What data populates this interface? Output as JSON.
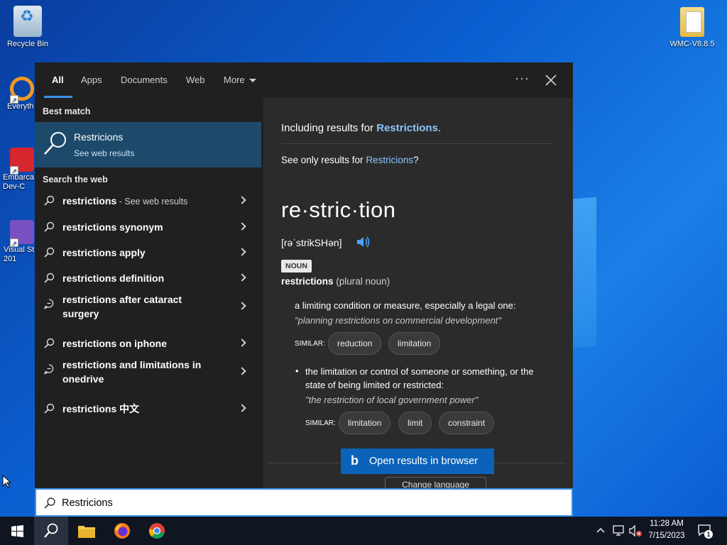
{
  "desktop": {
    "icons": [
      {
        "label": "Recycle Bin"
      },
      {
        "label": "WMC-V8.8.5"
      },
      {
        "label": "Everyth"
      },
      {
        "label": "Embarca Dev-C"
      },
      {
        "label": "Visual St 201"
      }
    ]
  },
  "tabs": [
    {
      "label": "All",
      "active": true
    },
    {
      "label": "Apps"
    },
    {
      "label": "Documents"
    },
    {
      "label": "Web"
    },
    {
      "label": "More"
    }
  ],
  "header_icons": {
    "more": "more-options-icon",
    "close": "close-icon"
  },
  "left": {
    "best_match_title": "Best match",
    "best_match": {
      "title": "Restricions",
      "subtitle": "See web results"
    },
    "web_title": "Search the web",
    "results": [
      {
        "text": "restrictions",
        "hint": " - See web results",
        "icon": "search-icon"
      },
      {
        "text": "restrictions synonym",
        "hint": "",
        "icon": "search-icon"
      },
      {
        "text": "restrictions apply",
        "hint": "",
        "icon": "search-icon"
      },
      {
        "text": "restrictions definition",
        "hint": "",
        "icon": "search-icon"
      },
      {
        "text": "restrictions after cataract surgery",
        "hint": "",
        "icon": "chat-bubble-icon"
      },
      {
        "text": "restrictions on iphone",
        "hint": "",
        "icon": "search-icon"
      },
      {
        "text": "restrictions and limitations in onedrive",
        "hint": "",
        "icon": "chat-bubble-icon"
      },
      {
        "text": "restrictions 中文",
        "hint": "",
        "icon": "search-icon"
      }
    ]
  },
  "right": {
    "including_prefix": "Including results for ",
    "including_term": "Restrictions",
    "including_suffix": ".",
    "only_prefix": "See only results for ",
    "only_term": "Restricions",
    "only_suffix": "?",
    "headword": "re·stric·tion",
    "pronunciation": "[rəˈstrikSHən]",
    "part_of_speech": "NOUN",
    "lemma": "restrictions",
    "lemma_note": " (plural noun)",
    "senses": [
      {
        "definition": "a limiting condition or measure, especially a legal one:",
        "example": "\"planning restrictions on commercial development\"",
        "similar_label": "SIMILAR:",
        "similar": [
          "reduction",
          "limitation"
        ]
      },
      {
        "definition": "the limitation or control of someone or something, or the state of being limited or restricted:",
        "example": "\"the restriction of local government power\"",
        "similar_label": "SIMILAR:",
        "similar": [
          "limitation",
          "limit",
          "constraint"
        ]
      }
    ],
    "bullet": "•",
    "open_browser": "Open results in browser",
    "change_language": "Change language"
  },
  "search": {
    "value": "Restricions"
  },
  "taskbar": {
    "time": "11:28 AM",
    "date": "7/15/2023",
    "notification_count": "1"
  },
  "colors": {
    "accent": "#3c91e6",
    "best_match_bg": "#1d4a6a",
    "link": "#8cc5ff",
    "open_button": "#0b62b8"
  }
}
